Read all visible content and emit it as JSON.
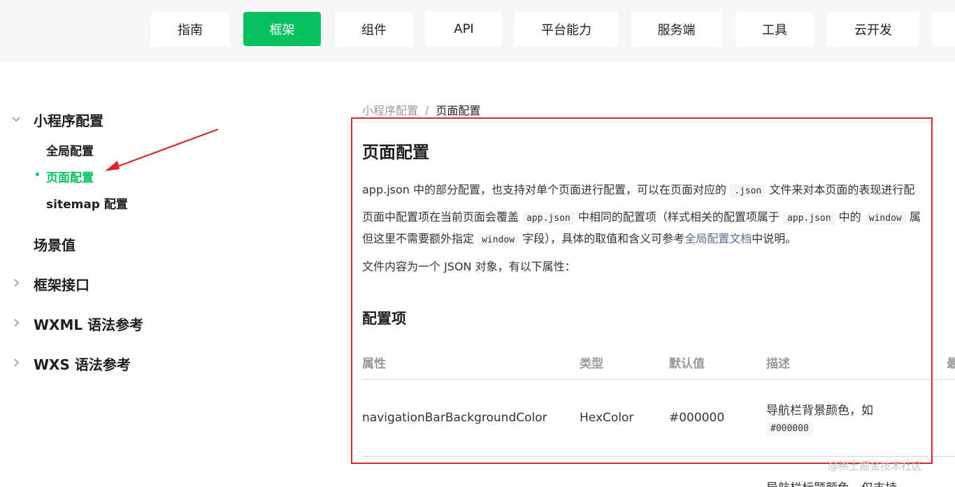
{
  "topnav": {
    "tabs": [
      {
        "label": "指南"
      },
      {
        "label": "框架"
      },
      {
        "label": "组件"
      },
      {
        "label": "API"
      },
      {
        "label": "平台能力"
      },
      {
        "label": "服务端"
      },
      {
        "label": "工具"
      },
      {
        "label": "云开发"
      }
    ],
    "active_color": "#07c160"
  },
  "sidebar": {
    "sections": [
      {
        "label": "小程序配置",
        "expanded": true,
        "icon": "chevron-down-icon"
      },
      {
        "label": "场景值"
      },
      {
        "label": "框架接口",
        "icon": "chevron-right-icon"
      },
      {
        "label": "WXML 语法参考",
        "icon": "chevron-right-icon"
      },
      {
        "label": "WXS 语法参考",
        "icon": "chevron-right-icon"
      }
    ],
    "sub_items": [
      {
        "label": "全局配置"
      },
      {
        "label": "页面配置",
        "active": true
      },
      {
        "label": "sitemap 配置"
      }
    ]
  },
  "breadcrumb": {
    "parent": "小程序配置",
    "separator": "/",
    "current": "页面配置"
  },
  "content": {
    "title": "页面配置",
    "p1": {
      "a": "app.json 中的部分配置，也支持对单个页面进行配置，可以在页面对应的",
      "code": ".json",
      "b": "文件来对本页面的表现进行配"
    },
    "p2": {
      "a": "页面中配置项在当前页面会覆盖",
      "code1": "app.json",
      "b": "中相同的配置项（样式相关的配置项属于",
      "code2": "app.json",
      "c": "中的",
      "code3": "window",
      "d": "属"
    },
    "p3": {
      "a": "但这里不需要额外指定",
      "code": "window",
      "b": "字段），具体的取值和含义可参考",
      "link": "全局配置文档",
      "c": "中说明。"
    },
    "p4": "文件内容为一个 JSON 对象，有以下属性：",
    "section_title": "配置项"
  },
  "table": {
    "headers": [
      "属性",
      "类型",
      "默认值",
      "描述",
      "最"
    ],
    "rows": [
      {
        "property": "navigationBarBackgroundColor",
        "type": "HexColor",
        "default": "#000000",
        "desc_text": "导航栏背景颜色，如",
        "desc_code": "#000000"
      }
    ],
    "next_row_desc": "导航栏标题颜色，仅支持"
  },
  "watermark": "@稀土掘金技术社区",
  "annotation_color": "#d9272e"
}
